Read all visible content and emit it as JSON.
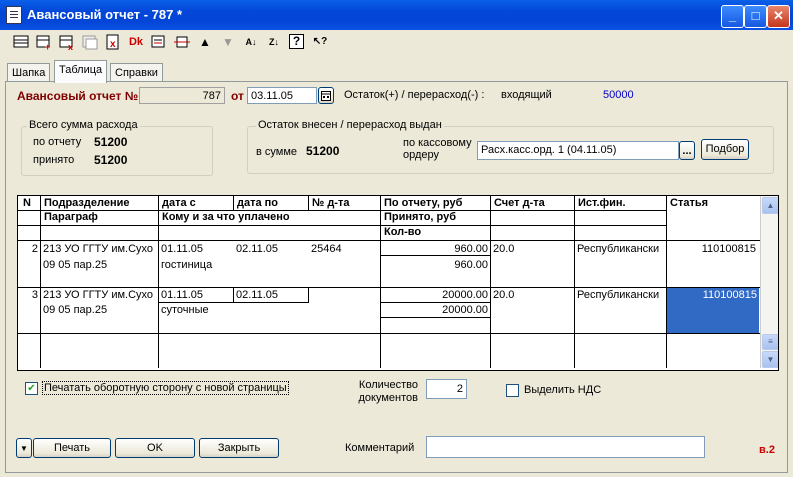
{
  "window": {
    "title": "Авансовый отчет - 787 *",
    "minimize": "_",
    "maximize": "□",
    "close": "✕"
  },
  "toolbar": [
    "new-row-icon",
    "insert-row-icon",
    "delete-row-icon",
    "copy-row-icon",
    "delete-doc-icon",
    "dk-icon",
    "edit-row-icon",
    "settings-row-icon",
    "arrow-up-icon",
    "arrow-down-icon",
    "sort-asc-icon",
    "sort-desc-icon",
    "help-icon",
    "pointer-help-icon"
  ],
  "toolbar_glyphs": {
    "dk": "Dk",
    "up": "▲",
    "down": "▼",
    "az": "A↓",
    "za": "Z↓",
    "help": "?",
    "ptr": "↖?"
  },
  "tabs": [
    "Шапка",
    "Таблица",
    "Справки"
  ],
  "header": {
    "report_label": "Авансовый отчет №",
    "number": "787",
    "from_label": "от",
    "date": "03.11.05",
    "balance_label": "Остаток(+) / перерасход(-) :",
    "incoming_label": "входящий",
    "incoming_value": "50000"
  },
  "totals": {
    "title": "Всего сумма расхода",
    "by_report_label": "по отчету",
    "by_report_value": "51200",
    "accepted_label": "принято",
    "accepted_value": "51200"
  },
  "balance": {
    "title": "Остаток внесен / перерасход выдан",
    "sum_label": "в сумме",
    "sum_value": "51200",
    "order_label": "по кассовому ордеру",
    "order_value": "Расх.касс.орд. 1 (04.11.05)",
    "ellipsis": "...",
    "select_button": "Подбор"
  },
  "grid": {
    "headers": {
      "n": "N",
      "division": "Подразделение",
      "paragraph": "Параграф",
      "date_from": "дата с",
      "date_to": "дата по",
      "doc_no": "№ д-та",
      "whom": "Кому и за что уплачено",
      "by_report": "По отчету, руб",
      "accepted": "Принято, руб",
      "qty": "Кол-во",
      "account": "Счет д-та",
      "source": "Ист.фин.",
      "article": "Статья"
    },
    "rows": [
      {
        "n": "2",
        "division": "213 УО ГГТУ им.Сухо",
        "paragraph": "09 05 пар.25",
        "date_from": "01.11.05",
        "date_to": "02.11.05",
        "doc_no": "25464",
        "whom": "гостиница",
        "by_report": "960.00",
        "accepted": "960.00",
        "account": "20.0",
        "source": "Республикански",
        "article": "110100815"
      },
      {
        "n": "3",
        "division": "213 УО ГГТУ им.Сухо",
        "paragraph": "09 05 пар.25",
        "date_from": "01.11.05",
        "date_to": "02.11.05",
        "doc_no": "",
        "whom": "суточные",
        "by_report": "20000.00",
        "accepted": "20000.00",
        "account": "20.0",
        "source": "Республикански",
        "article": "110100815"
      }
    ]
  },
  "footer": {
    "print_back_label": "Печатать оборотную сторону с новой страницы",
    "print_back_checked": true,
    "docs_count_label_1": "Количество",
    "docs_count_label_2": "документов",
    "docs_count": "2",
    "vat_label": "Выделить НДС",
    "vat_checked": false,
    "comment_label": "Комментарий",
    "comment_value": "",
    "print_button": "Печать",
    "ok_button": "OK",
    "close_button": "Закрыть",
    "version": "в.2"
  },
  "colors": {
    "title_bar": "#0346d8",
    "header_label": "#800000",
    "incoming_value": "#0000cc",
    "selection": "#316ac5",
    "version": "#cc0000"
  }
}
